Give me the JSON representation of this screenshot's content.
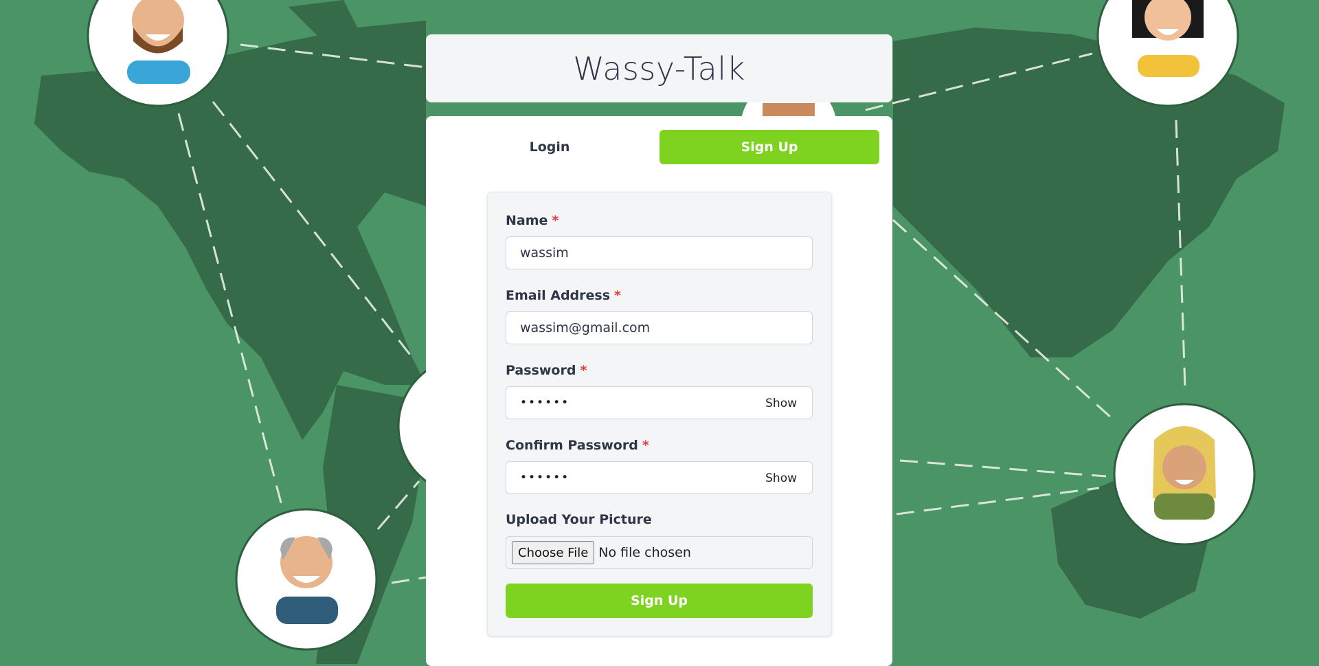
{
  "app": {
    "title": "Wassy-Talk"
  },
  "tabs": [
    {
      "label": "Login",
      "active": false
    },
    {
      "label": "Sign Up",
      "active": true
    }
  ],
  "form": {
    "name": {
      "label": "Name",
      "required_mark": "*",
      "value": "wassim"
    },
    "email": {
      "label": "Email Address",
      "required_mark": "*",
      "value": "wassim@gmail.com"
    },
    "password": {
      "label": "Password",
      "required_mark": "*",
      "masked_value": "••••••",
      "toggle_label": "Show"
    },
    "confirm_password": {
      "label": "Confirm Password",
      "required_mark": "*",
      "masked_value": "••••••",
      "toggle_label": "Show"
    },
    "picture": {
      "label": "Upload Your Picture",
      "button_label": "Choose File",
      "status": "No file chosen"
    },
    "submit_label": "Sign Up"
  },
  "colors": {
    "accent": "#7ed321",
    "background": "#4a9466",
    "map": "#346a47",
    "required": "#e53e3e"
  }
}
